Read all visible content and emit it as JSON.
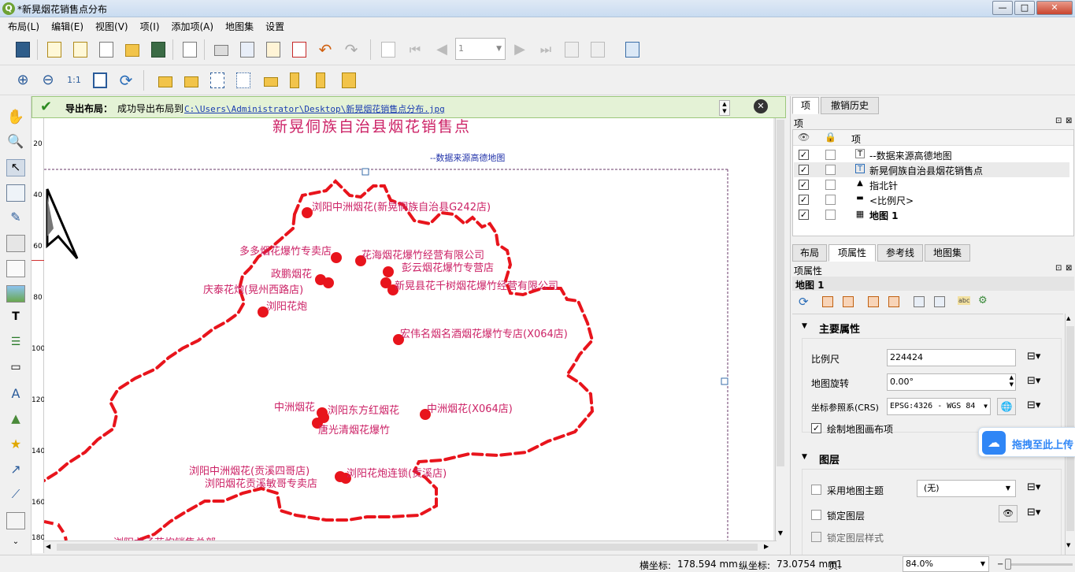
{
  "window": {
    "title": "*新晃烟花销售点分布",
    "min": "—",
    "max": "□",
    "close": "✕"
  },
  "menu": [
    "布局(L)",
    "编辑(E)",
    "视图(V)",
    "项(I)",
    "添加项(A)",
    "地图集",
    "设置"
  ],
  "toolbar": {
    "page_number": "1"
  },
  "message": {
    "title": "导出布局：",
    "text": "成功导出布局到",
    "path": "C:\\Users\\Administrator\\Desktop\\新晃烟花销售点分布.jpg"
  },
  "map": {
    "title": "新晃侗族自治县烟花销售点",
    "source": "--数据来源高德地图",
    "ruler_ticks": [
      "20",
      "40",
      "60",
      "80",
      "100",
      "120",
      "140",
      "160",
      "180"
    ],
    "points": [
      {
        "name": "浏阳中洲烟花(新晃侗族自治县G242店)"
      },
      {
        "name": "多多烟花爆竹专卖店"
      },
      {
        "name": "花海烟花爆竹经营有限公司"
      },
      {
        "name": "彭云烟花爆竹专营店"
      },
      {
        "name": "政鹏烟花"
      },
      {
        "name": "庆泰花炮(晃州西路店)"
      },
      {
        "name": "新晃县花千树烟花爆竹经营有限公司"
      },
      {
        "name": "浏阳花炮"
      },
      {
        "name": "宏伟名烟名酒烟花爆竹专店(X064店)"
      },
      {
        "name": "中洲烟花"
      },
      {
        "name": "浏阳东方红烟花"
      },
      {
        "name": "中洲烟花(X064店)"
      },
      {
        "name": "唐光清烟花爆竹"
      },
      {
        "name": "浏阳中洲烟花(贡溪四哥店)"
      },
      {
        "name": "浏阳花炮连锁(贡溪店)"
      },
      {
        "name": "浏阳烟花贡溪敏哥专卖店"
      },
      {
        "name": "浏阳龙子花炮销售总部"
      }
    ]
  },
  "right": {
    "tabs_top": [
      "项",
      "撤销历史"
    ],
    "items_label": "项",
    "items_header": "项",
    "items": [
      {
        "label": "--数据来源高德地图",
        "icon": "T"
      },
      {
        "label": "新晃侗族自治县烟花销售点",
        "icon": "T"
      },
      {
        "label": "指北针",
        "icon": "▲"
      },
      {
        "label": "<比例尺>",
        "icon": "▬"
      },
      {
        "label": "地图 1",
        "icon": "▦"
      }
    ],
    "tabs_bottom": [
      "布局",
      "项属性",
      "参考线",
      "地图集"
    ],
    "props_label": "项属性",
    "item_name": "地图 1",
    "main_section": "主要属性",
    "scale_label": "比例尺",
    "scale_value": "224424",
    "rotation_label": "地图旋转",
    "rotation_value": "0.00°",
    "crs_label": "坐标参照系(CRS)",
    "crs_value": "EPSG:4326 - WGS 84",
    "draw_items_label": "绘制地图画布项",
    "layers_section": "图层",
    "theme_label": "采用地图主题",
    "theme_value": "(无)",
    "lock_layers_label": "锁定图层",
    "lock_styles_label": "锁定图层样式",
    "baidu_text": "拖拽至此上传"
  },
  "status": {
    "x_label": "横坐标:",
    "x_value": "178.594 mm",
    "y_label": "纵坐标:",
    "y_value": "73.0754 mm",
    "page_label": "页:",
    "page_value": "1",
    "zoom": "84.0%"
  },
  "colors": {
    "route": "#e8141c",
    "point": "#e8141c",
    "label": "#cc2266",
    "source": "#2233aa",
    "success": "#2e8b22"
  }
}
